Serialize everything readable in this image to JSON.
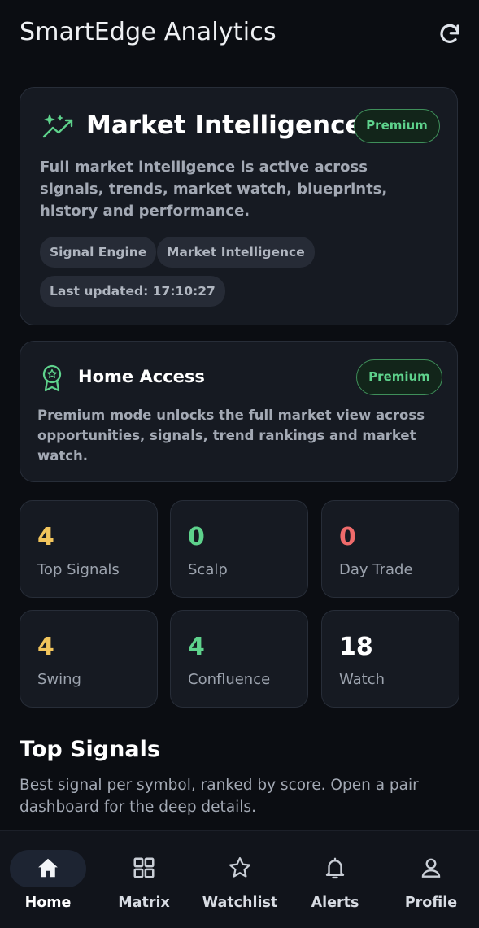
{
  "header": {
    "title": "SmartEdge Analytics",
    "refresh_icon": "refresh-icon"
  },
  "market_intelligence": {
    "icon": "sparkle-trend-icon",
    "title": "Market Intelligence",
    "badge": "Premium",
    "description": "Full market intelligence is active across signals, trends, market watch, blueprints, history and performance.",
    "chips": [
      "Signal Engine",
      "Market Intelligence",
      "Last updated: 17:10:27"
    ]
  },
  "home_access": {
    "icon": "award-icon",
    "title": "Home Access",
    "badge": "Premium",
    "description": "Premium mode unlocks the full market view across opportunities, signals, trend rankings and market watch."
  },
  "stats": [
    {
      "value": "4",
      "label": "Top Signals",
      "color": "#f2c55c"
    },
    {
      "value": "0",
      "label": "Scalp",
      "color": "#5ed28c"
    },
    {
      "value": "0",
      "label": "Day Trade",
      "color": "#ef6b6b"
    },
    {
      "value": "4",
      "label": "Swing",
      "color": "#f2c55c"
    },
    {
      "value": "4",
      "label": "Confluence",
      "color": "#5ed28c"
    },
    {
      "value": "18",
      "label": "Watch",
      "color": "#ffffff"
    }
  ],
  "top_signals": {
    "title": "Top Signals",
    "description": "Best signal per symbol, ranked by score. Open a pair dashboard for the deep details."
  },
  "nav": [
    {
      "label": "Home",
      "icon": "home-icon",
      "active": true
    },
    {
      "label": "Matrix",
      "icon": "grid-icon",
      "active": false
    },
    {
      "label": "Watchlist",
      "icon": "star-icon",
      "active": false
    },
    {
      "label": "Alerts",
      "icon": "bell-icon",
      "active": false
    },
    {
      "label": "Profile",
      "icon": "user-icon",
      "active": false
    }
  ],
  "colors": {
    "accent": "#5ed28c",
    "background": "#0b0d12",
    "card": "#161a22"
  }
}
